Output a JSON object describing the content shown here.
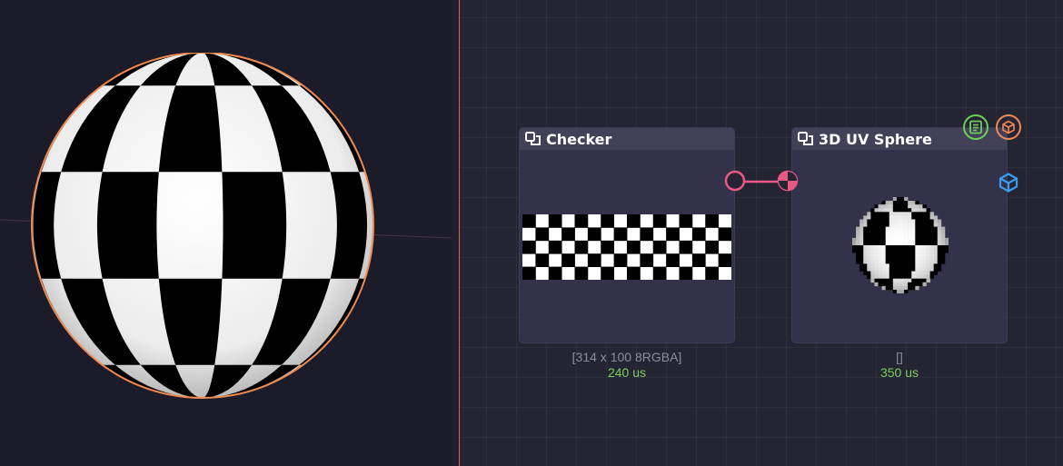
{
  "graph": {
    "nodes": [
      {
        "id": "checker",
        "title": "Checker",
        "icon": "node-copy-icon",
        "info": "[314 x 100 8RGBA]",
        "time": "240 us"
      },
      {
        "id": "uv_sphere",
        "title": "3D UV Sphere",
        "icon": "node-copy-icon",
        "info": "[]",
        "time": "350 us",
        "actions": [
          {
            "icon": "document-icon",
            "color": "#6fcf5a"
          },
          {
            "icon": "cube-icon",
            "color": "#f08a50"
          }
        ],
        "input_type_icon": "cube-icon",
        "input_type_color": "#3a9cf0"
      }
    ],
    "connection": {
      "from": "checker",
      "to": "uv_sphere",
      "color": "#e85a84"
    }
  },
  "colors": {
    "graph_background": "#242433",
    "viewport_background": "#1c1b29",
    "node_body": "#33324a",
    "node_header": "#424158",
    "selection_outline": "#f08a50",
    "divider": "#c86a44",
    "stat_time": "#7ccf5d",
    "stat_info": "#8d8ca0"
  }
}
